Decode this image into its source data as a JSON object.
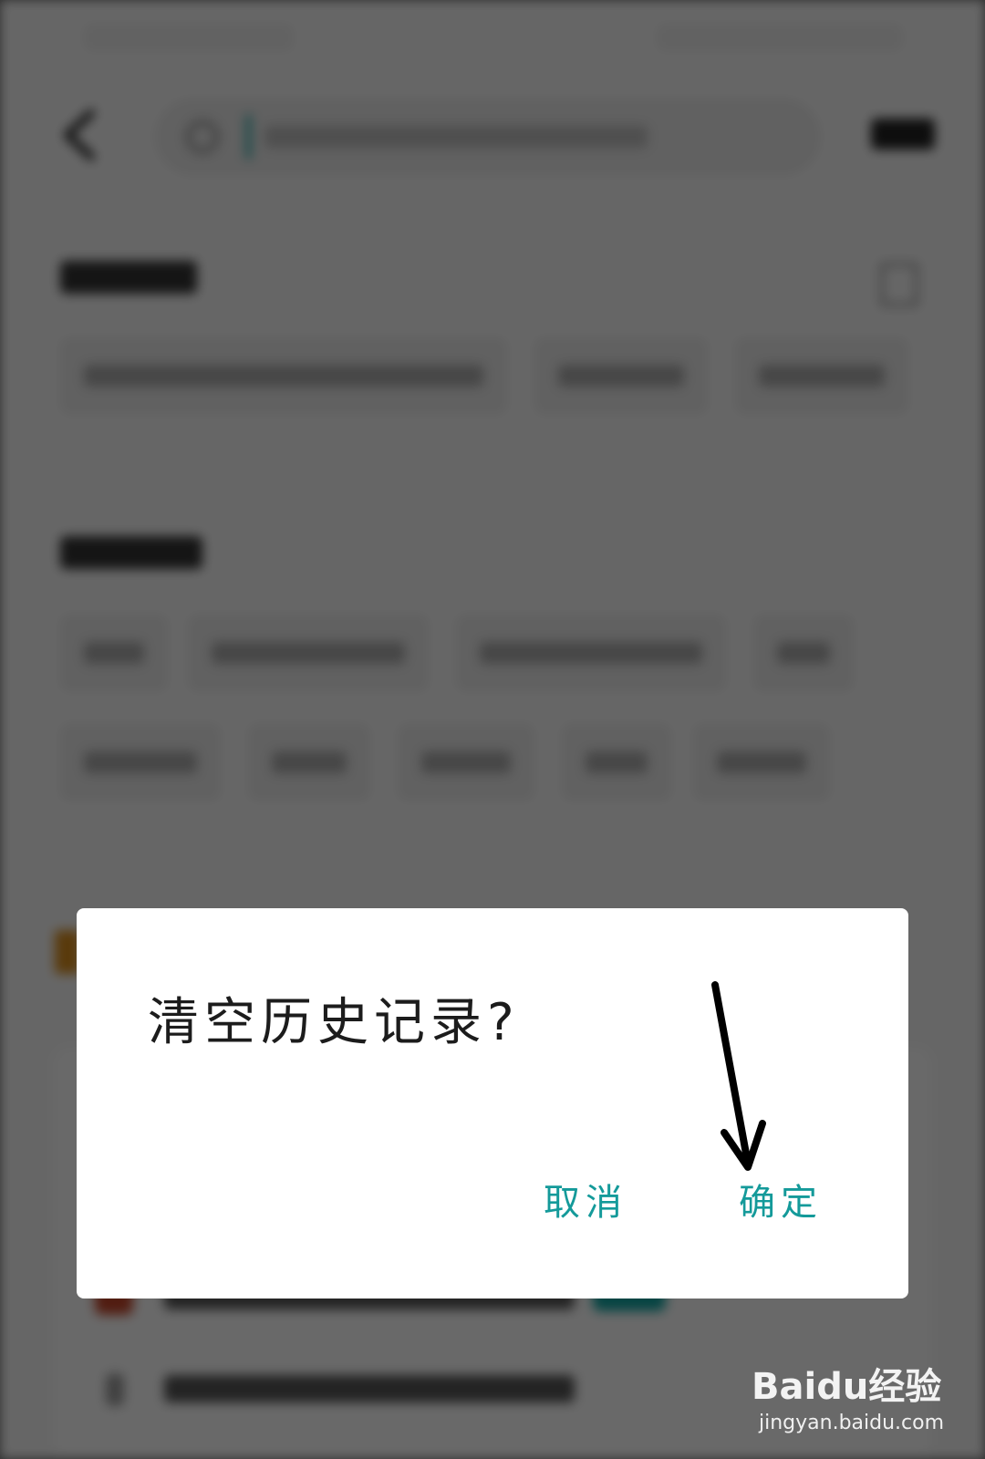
{
  "dialog": {
    "title": "清空历史记录?",
    "cancel_label": "取消",
    "confirm_label": "确定"
  },
  "background_app": {
    "search": {
      "icon": "search-icon"
    },
    "history": {
      "icon": "trash-icon"
    }
  },
  "watermark": {
    "logo_text": "Baidu经验",
    "url": "jingyan.baidu.com"
  },
  "colors": {
    "accent": "#149a9a",
    "overlay": "#6a6a6a",
    "dialog_bg": "#ffffff",
    "title_text": "#1c1c1c"
  }
}
